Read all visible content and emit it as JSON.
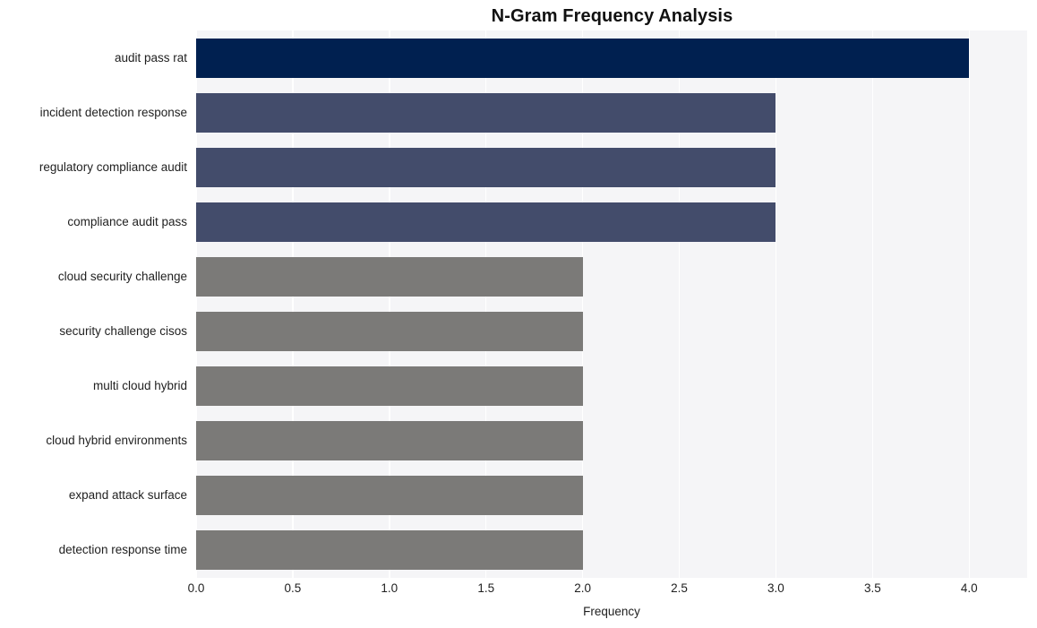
{
  "chart_data": {
    "type": "bar",
    "orientation": "horizontal",
    "title": "N-Gram Frequency Analysis",
    "xlabel": "Frequency",
    "ylabel": "",
    "categories": [
      "audit pass rat",
      "incident detection response",
      "regulatory compliance audit",
      "compliance audit pass",
      "cloud security challenge",
      "security challenge cisos",
      "multi cloud hybrid",
      "cloud hybrid environments",
      "expand attack surface",
      "detection response time"
    ],
    "values": [
      4,
      3,
      3,
      3,
      2,
      2,
      2,
      2,
      2,
      2
    ],
    "bar_colors": [
      "#002050",
      "#434c6b",
      "#434c6b",
      "#434c6b",
      "#7b7a78",
      "#7b7a78",
      "#7b7a78",
      "#7b7a78",
      "#7b7a78",
      "#7b7a78"
    ],
    "xlim": [
      0.0,
      4.3
    ],
    "ylim": [
      0,
      10
    ],
    "xticks": [
      "0.0",
      "0.5",
      "1.0",
      "1.5",
      "2.0",
      "2.5",
      "3.0",
      "3.5",
      "4.0"
    ],
    "xtick_values": [
      0.0,
      0.5,
      1.0,
      1.5,
      2.0,
      2.5,
      3.0,
      3.5,
      4.0
    ],
    "grid": "vertical-white",
    "legend": "none",
    "plot_background": "#f5f5f7",
    "figure_background": "#ffffff"
  }
}
